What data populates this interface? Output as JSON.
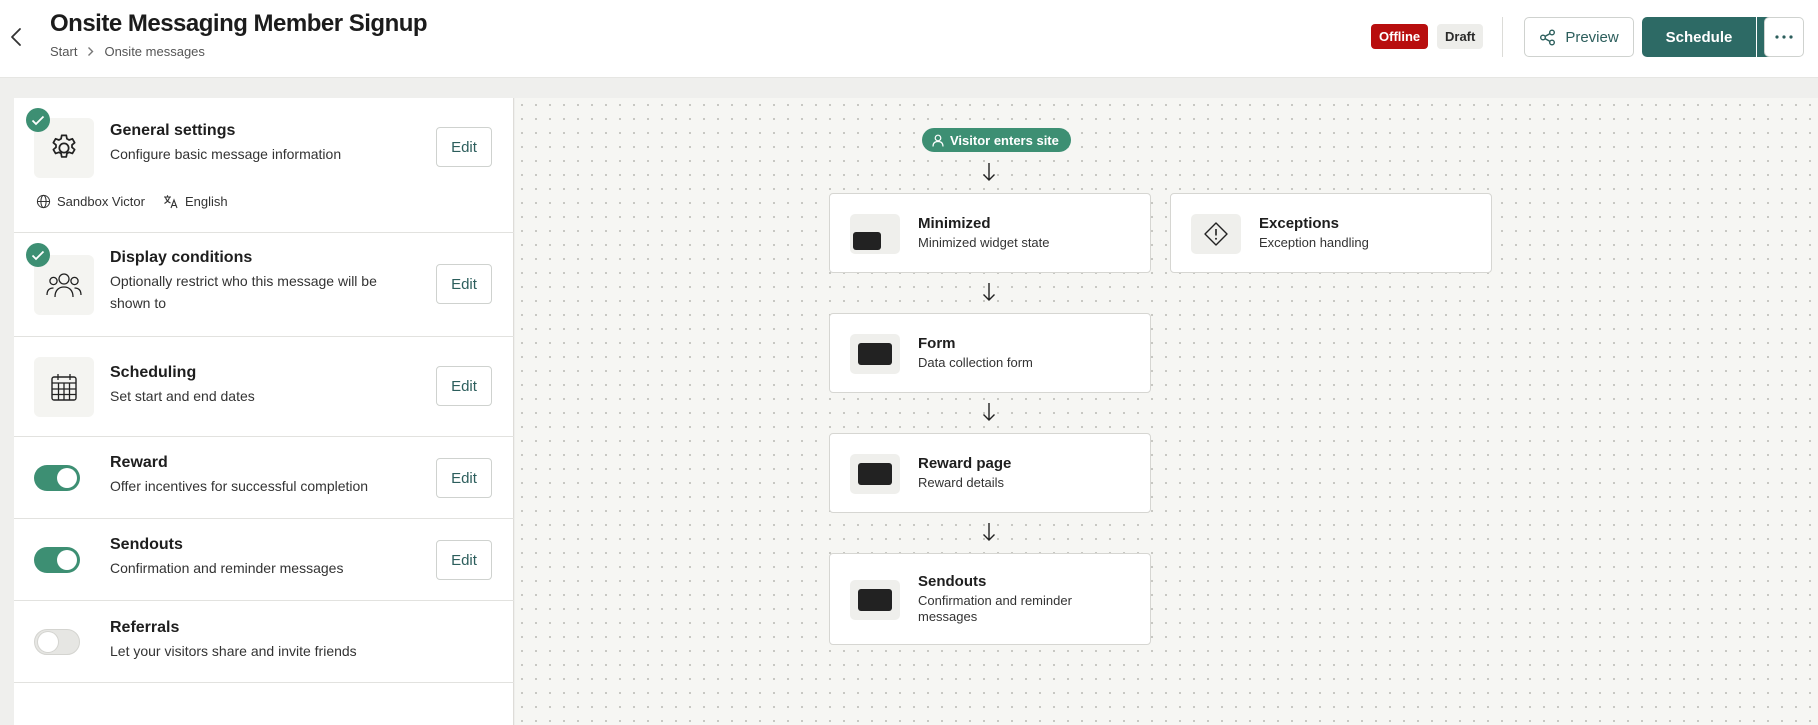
{
  "header": {
    "title": "Onsite Messaging Member Signup",
    "breadcrumb": [
      "Start",
      "Onsite messages"
    ],
    "status_offline": "Offline",
    "status_draft": "Draft",
    "preview_label": "Preview",
    "schedule_label": "Schedule"
  },
  "sections": {
    "general": {
      "title": "General settings",
      "desc": "Configure basic message information",
      "edit": "Edit",
      "site": "Sandbox Victor",
      "language": "English",
      "completed": true
    },
    "display": {
      "title": "Display conditions",
      "desc": "Optionally restrict who this message will be shown to",
      "edit": "Edit",
      "completed": true
    },
    "scheduling": {
      "title": "Scheduling",
      "desc": "Set start and end dates",
      "edit": "Edit"
    },
    "reward": {
      "title": "Reward",
      "desc": "Offer incentives for successful completion",
      "edit": "Edit",
      "enabled": true
    },
    "sendouts": {
      "title": "Sendouts",
      "desc": "Confirmation and reminder messages",
      "edit": "Edit",
      "enabled": true
    },
    "referrals": {
      "title": "Referrals",
      "desc": "Let your visitors share and invite friends",
      "enabled": false
    }
  },
  "flow": {
    "start": "Visitor enters site",
    "nodes": [
      {
        "title": "Minimized",
        "desc": "Minimized widget state"
      },
      {
        "title": "Form",
        "desc": "Data collection form"
      },
      {
        "title": "Reward page",
        "desc": "Reward details"
      },
      {
        "title": "Sendouts",
        "desc": "Confirmation and reminder messages"
      }
    ],
    "exceptions": {
      "title": "Exceptions",
      "desc": "Exception handling"
    }
  },
  "colors": {
    "accent": "#2d6a65",
    "success": "#3d8f73",
    "offline": "#b80e0e"
  },
  "icons": [
    "back-icon",
    "chevron-right-icon",
    "share-icon",
    "chevron-down-icon",
    "more-icon",
    "gear-icon",
    "checkmark-icon",
    "globe-icon",
    "translate-icon",
    "users-icon",
    "calendar-icon",
    "user-icon",
    "arrow-down-icon",
    "warning-diamond-icon"
  ]
}
